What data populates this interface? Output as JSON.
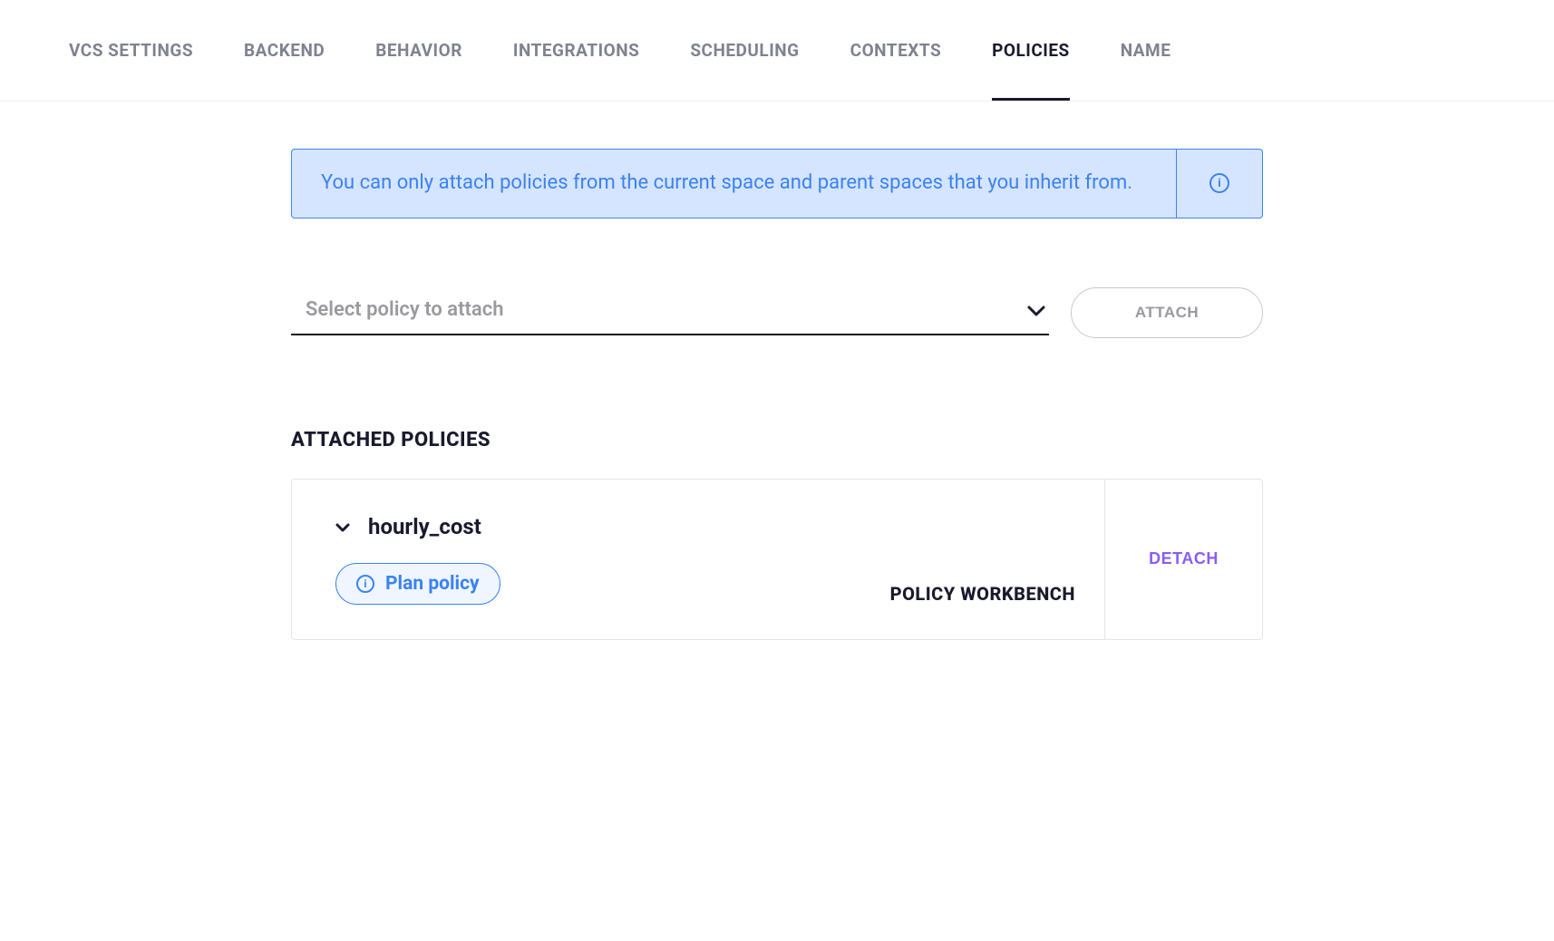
{
  "tabs": [
    {
      "label": "VCS SETTINGS",
      "active": false
    },
    {
      "label": "BACKEND",
      "active": false
    },
    {
      "label": "BEHAVIOR",
      "active": false
    },
    {
      "label": "INTEGRATIONS",
      "active": false
    },
    {
      "label": "SCHEDULING",
      "active": false
    },
    {
      "label": "CONTEXTS",
      "active": false
    },
    {
      "label": "POLICIES",
      "active": true
    },
    {
      "label": "NAME",
      "active": false
    }
  ],
  "banner": {
    "text": "You can only attach policies from the current space and parent spaces that you inherit from."
  },
  "selector": {
    "placeholder": "Select policy to attach",
    "attach_label": "ATTACH"
  },
  "section": {
    "heading": "ATTACHED POLICIES"
  },
  "attached_policies": [
    {
      "name": "hourly_cost",
      "badge_label": "Plan policy",
      "workbench_label": "POLICY WORKBENCH",
      "detach_label": "DETACH"
    }
  ]
}
